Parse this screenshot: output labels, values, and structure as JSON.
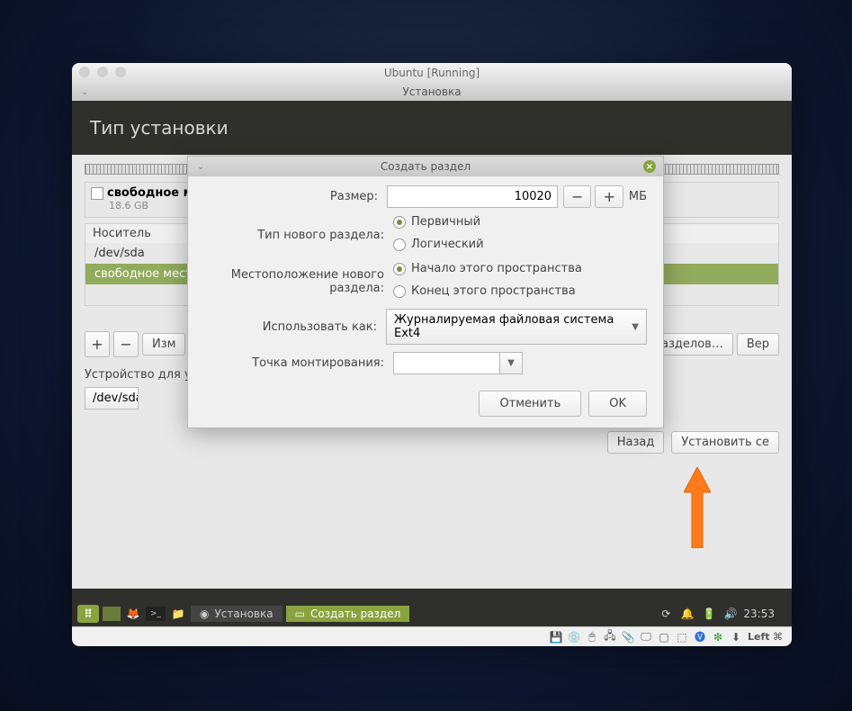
{
  "vbox": {
    "title": "Ubuntu [Running]"
  },
  "installer": {
    "window_title": "Установка",
    "header": "Тип установки"
  },
  "partition": {
    "free_label": "свободное место",
    "free_size": "18.6 GB",
    "device_header": "Носитель",
    "device_row": "/dev/sda",
    "free_row": "свободное место"
  },
  "toolbar": {
    "plus": "+",
    "minus": "−",
    "change": "Изм",
    "table_btn": "ца разделов…",
    "revert_btn": "Вер"
  },
  "bootloader": {
    "label": "Устройство для у",
    "value": "/dev/sda ATA VB"
  },
  "actions": {
    "back": "Назад",
    "install": "Установить се"
  },
  "dialog": {
    "title": "Создать раздел",
    "size_label": "Размер:",
    "size_value": "10020",
    "size_unit": "МБ",
    "type_label": "Тип нового раздела:",
    "type_primary": "Первичный",
    "type_logical": "Логический",
    "loc_label": "Местоположение нового раздела:",
    "loc_begin": "Начало этого пространства",
    "loc_end": "Конец этого пространства",
    "use_label": "Использовать как:",
    "use_value": "Журналируемая файловая система Ext4",
    "mount_label": "Точка монтирования:",
    "mount_value": "",
    "cancel": "Отменить",
    "ok": "OK"
  },
  "taskbar": {
    "task1": "Установка",
    "task2": "Создать раздел",
    "time": "23:53"
  },
  "vbox_status": {
    "keycap": "Left"
  }
}
